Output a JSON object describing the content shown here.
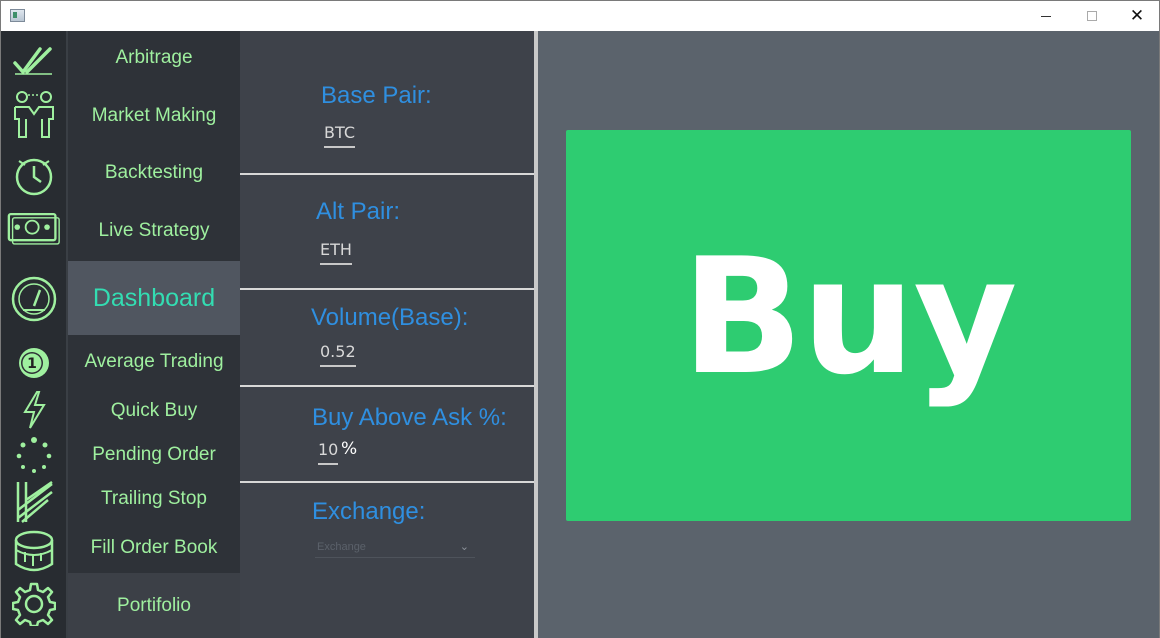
{
  "window": {
    "minimize_label": "—",
    "maximize_label": "☐",
    "close_label": "✕"
  },
  "iconbar": {
    "items": [
      {
        "name": "double-check-icon"
      },
      {
        "name": "handshake-icon"
      },
      {
        "name": "clock-icon"
      },
      {
        "name": "money-icon"
      },
      {
        "name": "speedometer-icon"
      },
      {
        "name": "number-one-icon"
      },
      {
        "name": "lightning-icon"
      },
      {
        "name": "loading-dots-icon"
      },
      {
        "name": "trailing-lines-icon"
      },
      {
        "name": "paint-bucket-icon"
      },
      {
        "name": "gear-icon"
      }
    ],
    "accent": "#9ff09f"
  },
  "menu": {
    "arbitrage": "Arbitrage",
    "market_making": "Market Making",
    "backtesting": "Backtesting",
    "live_strategy": "Live Strategy",
    "dashboard": "Dashboard",
    "average_trading": "Average Trading",
    "quick_buy": "Quick Buy",
    "pending_order": "Pending Order",
    "trailing_stop": "Trailing Stop",
    "fill_order_book": "Fill Order Book",
    "portfolio": "Portifolio"
  },
  "form": {
    "base_pair_label": "Base Pair:",
    "base_pair_value": "BTC",
    "alt_pair_label": "Alt Pair:",
    "alt_pair_value": "ETH",
    "volume_label": "Volume(Base):",
    "volume_value": "0.52",
    "buy_above_label": "Buy Above Ask %:",
    "buy_above_value": "10",
    "percent_sign": "%",
    "exchange_label": "Exchange:",
    "exchange_placeholder": "Exchange"
  },
  "main": {
    "buy_label": "Buy"
  },
  "colors": {
    "buy_green": "#2ecc71",
    "label_blue": "#2f8fe0",
    "dashboard_teal": "#33ddb2",
    "menu_green": "#9ff09f"
  }
}
